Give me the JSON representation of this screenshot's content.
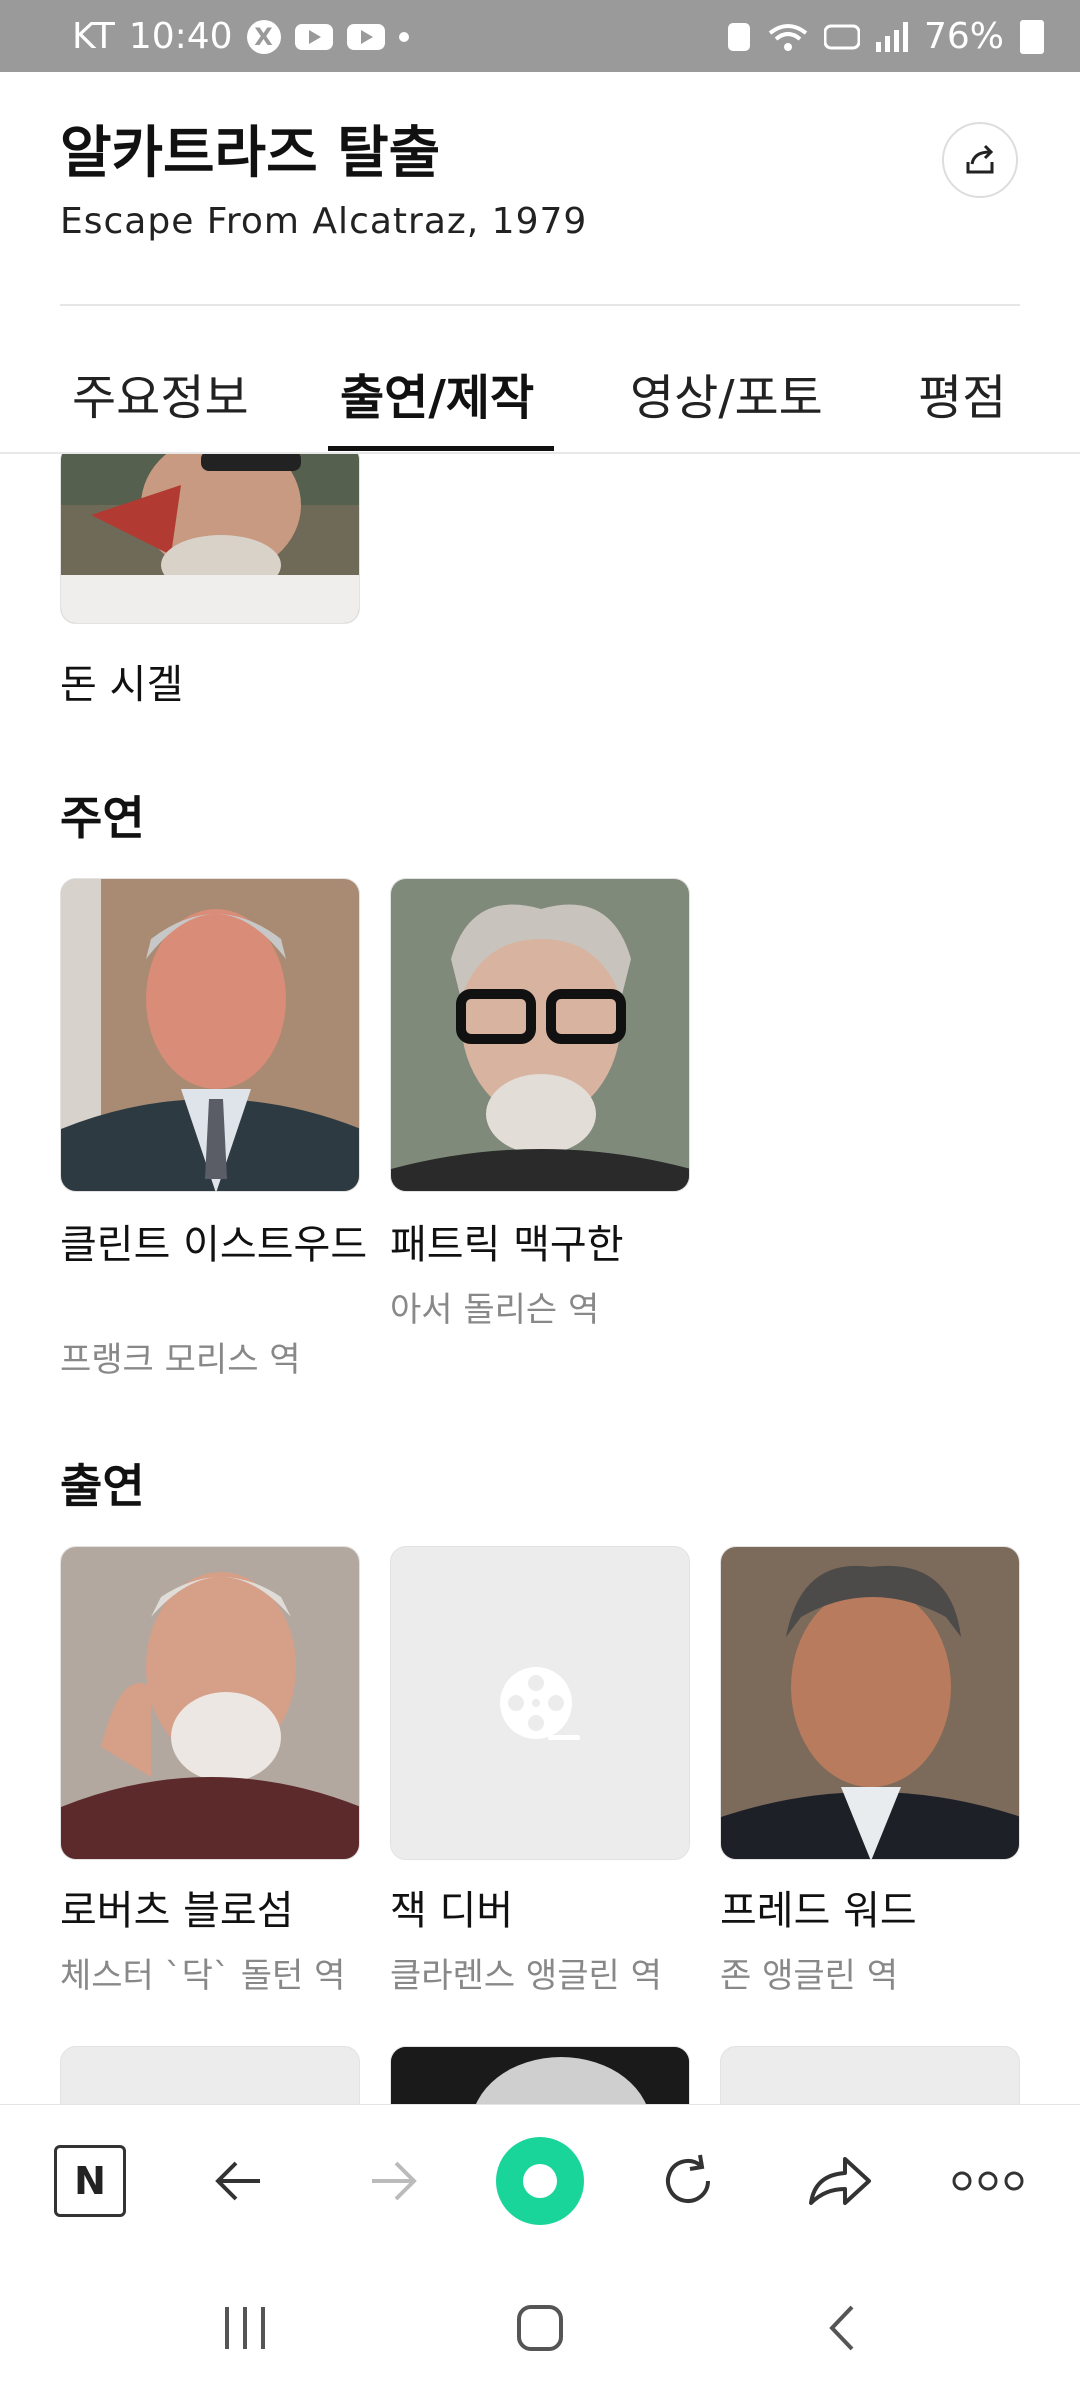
{
  "status_bar": {
    "carrier": "KT",
    "time": "10:40",
    "battery": "76%"
  },
  "header": {
    "title": "알카트라즈 탈출",
    "subtitle": "Escape From Alcatraz, 1979"
  },
  "tabs": [
    {
      "label": "주요정보",
      "active": false
    },
    {
      "label": "출연/제작",
      "active": true
    },
    {
      "label": "영상/포토",
      "active": false
    },
    {
      "label": "평점",
      "active": false
    }
  ],
  "director": {
    "name": "돈 시겔"
  },
  "sections": {
    "lead_title": "주연",
    "cast_title": "출연"
  },
  "lead_cast": [
    {
      "name": "클린트 이스트우드",
      "role": "프랭크 모리스 역"
    },
    {
      "name": "패트릭 맥구한",
      "role": "아서 돌리슨 역"
    }
  ],
  "supporting_cast": [
    {
      "name": "로버츠 블로섬",
      "role": "체스터 `닥` 돌턴 역"
    },
    {
      "name": "잭 디버",
      "role": "클라렌스 앵글린 역"
    },
    {
      "name": "프레드 워드",
      "role": "존 앵글린 역"
    }
  ],
  "browser_toolbar": {
    "naver_label": "N"
  },
  "colors": {
    "accent_green": "#19d59a",
    "status_bar": "#9a9a9a"
  }
}
